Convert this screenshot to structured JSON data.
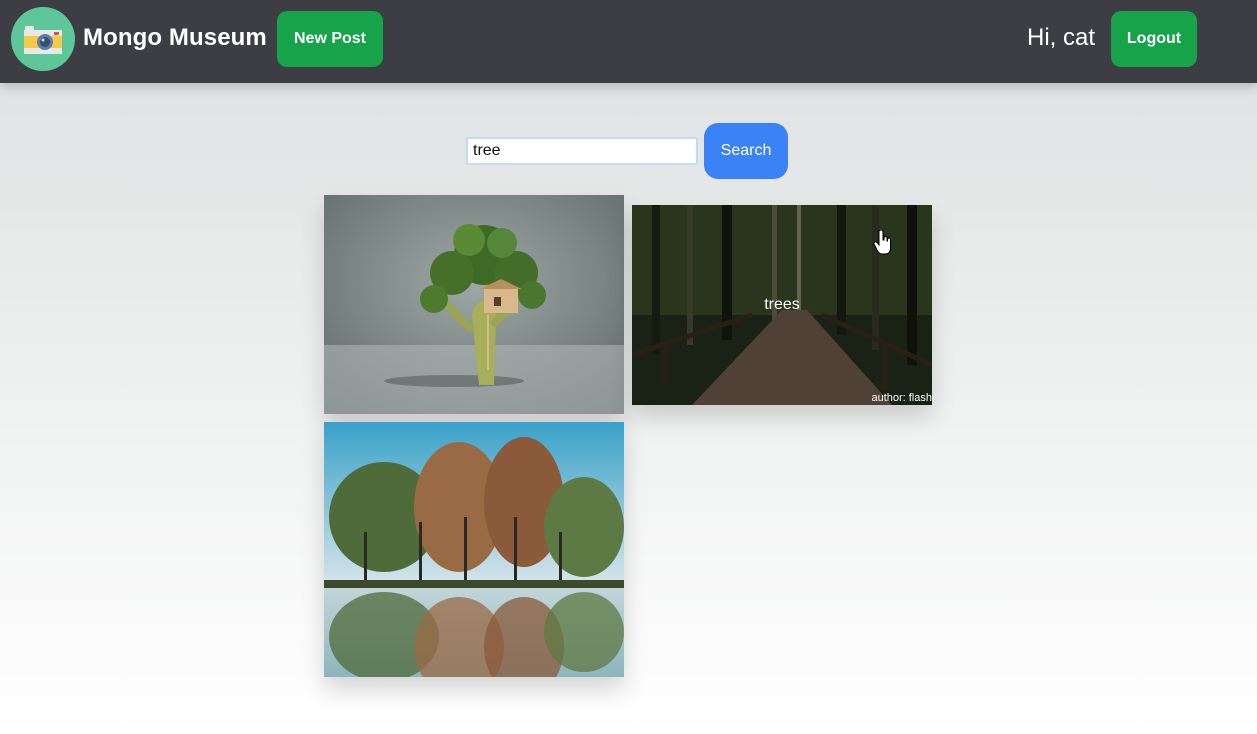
{
  "navbar": {
    "brand": "Mongo Museum",
    "new_post_label": "New Post",
    "greeting": "Hi, cat",
    "logout_label": "Logout",
    "logo_icon": "camera-icon",
    "bg_color": "#3d3e43",
    "button_color": "#16a34a"
  },
  "search": {
    "value": "tree",
    "button_label": "Search",
    "button_color": "#3b82f6"
  },
  "gallery": {
    "posts": [
      {
        "image": "broccoli-treehouse-photo",
        "title": "",
        "author": ""
      },
      {
        "image": "forest-path-photo",
        "title": "trees",
        "author": "author: flash"
      },
      {
        "image": "lake-trees-reflection-photo",
        "title": "",
        "author": ""
      }
    ]
  }
}
